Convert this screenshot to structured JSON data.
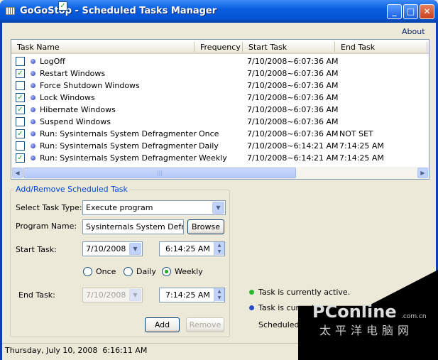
{
  "window": {
    "title": "GoGoStop - Scheduled Tasks Manager"
  },
  "about_link": "About",
  "list": {
    "columns": [
      "Task Name",
      "Frequency",
      "Start Task",
      "End Task"
    ],
    "rows": [
      {
        "checked": false,
        "name": "LogOff",
        "frequency": "",
        "start": "7/10/2008~6:07:36 AM",
        "end": ""
      },
      {
        "checked": true,
        "name": "Restart Windows",
        "frequency": "",
        "start": "7/10/2008~6:07:36 AM",
        "end": ""
      },
      {
        "checked": false,
        "name": "Force Shutdown Windows",
        "frequency": "",
        "start": "7/10/2008~6:07:36 AM",
        "end": ""
      },
      {
        "checked": true,
        "name": "Lock Windows",
        "frequency": "",
        "start": "7/10/2008~6:07:36 AM",
        "end": ""
      },
      {
        "checked": true,
        "name": "Hibernate Windows",
        "frequency": "",
        "start": "7/10/2008~6:07:36 AM",
        "end": ""
      },
      {
        "checked": false,
        "name": "Suspend Windows",
        "frequency": "",
        "start": "7/10/2008~6:07:36 AM",
        "end": ""
      },
      {
        "checked": true,
        "name": "Run: Sysinternals System Defragmenter",
        "frequency": "Once",
        "start": "7/10/2008~6:07:36 AM",
        "end": "NOT SET"
      },
      {
        "checked": false,
        "name": "Run: Sysinternals System Defragmenter",
        "frequency": "Daily",
        "start": "7/10/2008~6:14:21 AM",
        "end": "7:14:25 AM"
      },
      {
        "checked": true,
        "name": "Run: Sysinternals System Defragmenter",
        "frequency": "Weekly",
        "start": "7/10/2008~6:14:21 AM",
        "end": "7:14:25 AM"
      }
    ]
  },
  "form": {
    "group_title": "Add/Remove Scheduled Task",
    "task_type_label": "Select Task Type:",
    "task_type_value": "Execute program",
    "program_label": "Program Name:",
    "program_value": "Sysinternals System Defragmenter",
    "browse": "Browse",
    "start_label": "Start Task:",
    "start_date": "7/10/2008",
    "start_time": "6:14:25 AM",
    "freq_options": [
      "Once",
      "Daily",
      "Weekly"
    ],
    "freq_selected": "Weekly",
    "end_label": "End Task:",
    "end_checked": true,
    "end_date": "7/10/2008",
    "end_time": "7:14:25 AM",
    "add": "Add",
    "remove": "Remove"
  },
  "legend": {
    "active": "Task is currently active.",
    "inactive": "Task is current",
    "scheduled": "Scheduled Tas"
  },
  "status": "Thursday, July 10, 2008  6:16:11 AM",
  "watermark": {
    "brand": "PConline",
    "domain": ".com.cn",
    "chinese": "太平洋电脑网"
  }
}
